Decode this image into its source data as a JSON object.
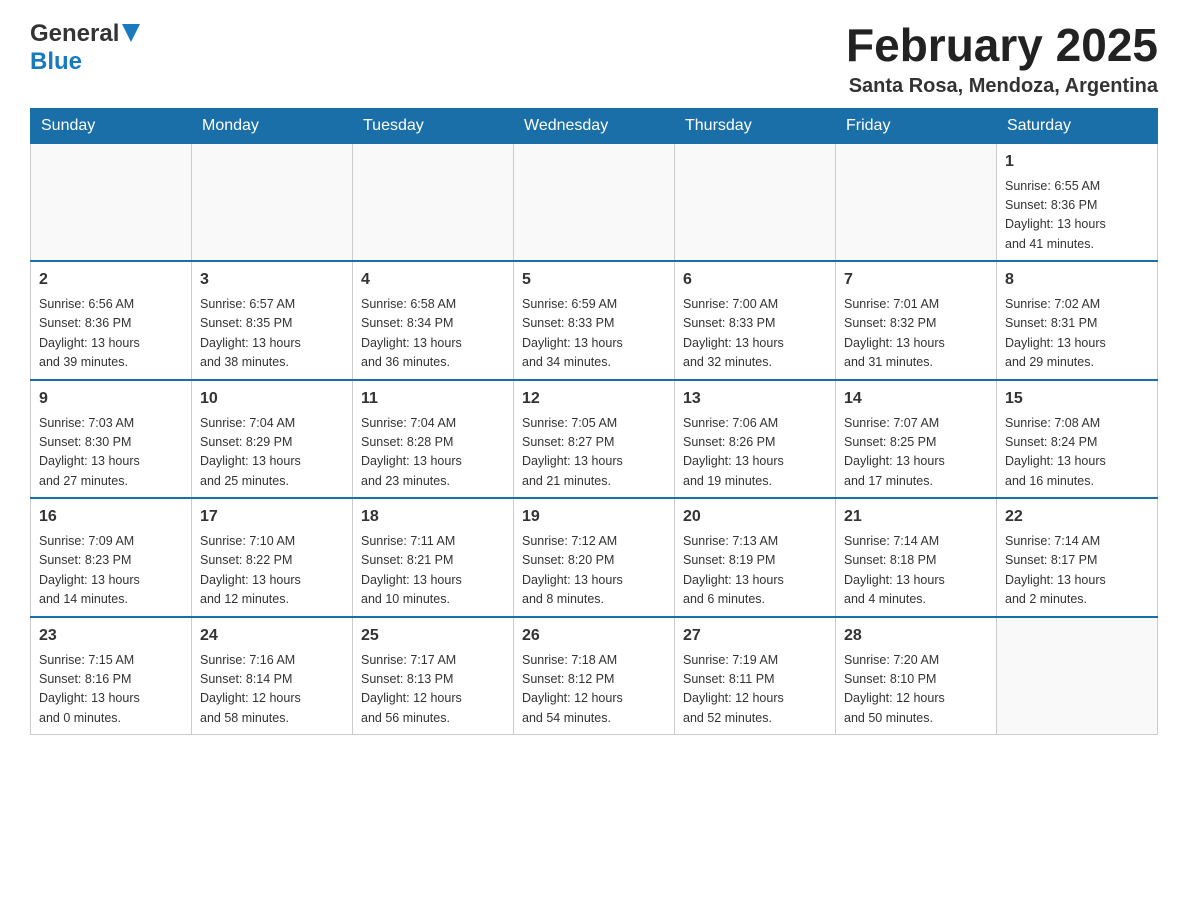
{
  "header": {
    "logo_general": "General",
    "logo_blue": "Blue",
    "month_title": "February 2025",
    "location": "Santa Rosa, Mendoza, Argentina"
  },
  "days_of_week": [
    "Sunday",
    "Monday",
    "Tuesday",
    "Wednesday",
    "Thursday",
    "Friday",
    "Saturday"
  ],
  "weeks": [
    [
      {
        "day": "",
        "info": ""
      },
      {
        "day": "",
        "info": ""
      },
      {
        "day": "",
        "info": ""
      },
      {
        "day": "",
        "info": ""
      },
      {
        "day": "",
        "info": ""
      },
      {
        "day": "",
        "info": ""
      },
      {
        "day": "1",
        "info": "Sunrise: 6:55 AM\nSunset: 8:36 PM\nDaylight: 13 hours\nand 41 minutes."
      }
    ],
    [
      {
        "day": "2",
        "info": "Sunrise: 6:56 AM\nSunset: 8:36 PM\nDaylight: 13 hours\nand 39 minutes."
      },
      {
        "day": "3",
        "info": "Sunrise: 6:57 AM\nSunset: 8:35 PM\nDaylight: 13 hours\nand 38 minutes."
      },
      {
        "day": "4",
        "info": "Sunrise: 6:58 AM\nSunset: 8:34 PM\nDaylight: 13 hours\nand 36 minutes."
      },
      {
        "day": "5",
        "info": "Sunrise: 6:59 AM\nSunset: 8:33 PM\nDaylight: 13 hours\nand 34 minutes."
      },
      {
        "day": "6",
        "info": "Sunrise: 7:00 AM\nSunset: 8:33 PM\nDaylight: 13 hours\nand 32 minutes."
      },
      {
        "day": "7",
        "info": "Sunrise: 7:01 AM\nSunset: 8:32 PM\nDaylight: 13 hours\nand 31 minutes."
      },
      {
        "day": "8",
        "info": "Sunrise: 7:02 AM\nSunset: 8:31 PM\nDaylight: 13 hours\nand 29 minutes."
      }
    ],
    [
      {
        "day": "9",
        "info": "Sunrise: 7:03 AM\nSunset: 8:30 PM\nDaylight: 13 hours\nand 27 minutes."
      },
      {
        "day": "10",
        "info": "Sunrise: 7:04 AM\nSunset: 8:29 PM\nDaylight: 13 hours\nand 25 minutes."
      },
      {
        "day": "11",
        "info": "Sunrise: 7:04 AM\nSunset: 8:28 PM\nDaylight: 13 hours\nand 23 minutes."
      },
      {
        "day": "12",
        "info": "Sunrise: 7:05 AM\nSunset: 8:27 PM\nDaylight: 13 hours\nand 21 minutes."
      },
      {
        "day": "13",
        "info": "Sunrise: 7:06 AM\nSunset: 8:26 PM\nDaylight: 13 hours\nand 19 minutes."
      },
      {
        "day": "14",
        "info": "Sunrise: 7:07 AM\nSunset: 8:25 PM\nDaylight: 13 hours\nand 17 minutes."
      },
      {
        "day": "15",
        "info": "Sunrise: 7:08 AM\nSunset: 8:24 PM\nDaylight: 13 hours\nand 16 minutes."
      }
    ],
    [
      {
        "day": "16",
        "info": "Sunrise: 7:09 AM\nSunset: 8:23 PM\nDaylight: 13 hours\nand 14 minutes."
      },
      {
        "day": "17",
        "info": "Sunrise: 7:10 AM\nSunset: 8:22 PM\nDaylight: 13 hours\nand 12 minutes."
      },
      {
        "day": "18",
        "info": "Sunrise: 7:11 AM\nSunset: 8:21 PM\nDaylight: 13 hours\nand 10 minutes."
      },
      {
        "day": "19",
        "info": "Sunrise: 7:12 AM\nSunset: 8:20 PM\nDaylight: 13 hours\nand 8 minutes."
      },
      {
        "day": "20",
        "info": "Sunrise: 7:13 AM\nSunset: 8:19 PM\nDaylight: 13 hours\nand 6 minutes."
      },
      {
        "day": "21",
        "info": "Sunrise: 7:14 AM\nSunset: 8:18 PM\nDaylight: 13 hours\nand 4 minutes."
      },
      {
        "day": "22",
        "info": "Sunrise: 7:14 AM\nSunset: 8:17 PM\nDaylight: 13 hours\nand 2 minutes."
      }
    ],
    [
      {
        "day": "23",
        "info": "Sunrise: 7:15 AM\nSunset: 8:16 PM\nDaylight: 13 hours\nand 0 minutes."
      },
      {
        "day": "24",
        "info": "Sunrise: 7:16 AM\nSunset: 8:14 PM\nDaylight: 12 hours\nand 58 minutes."
      },
      {
        "day": "25",
        "info": "Sunrise: 7:17 AM\nSunset: 8:13 PM\nDaylight: 12 hours\nand 56 minutes."
      },
      {
        "day": "26",
        "info": "Sunrise: 7:18 AM\nSunset: 8:12 PM\nDaylight: 12 hours\nand 54 minutes."
      },
      {
        "day": "27",
        "info": "Sunrise: 7:19 AM\nSunset: 8:11 PM\nDaylight: 12 hours\nand 52 minutes."
      },
      {
        "day": "28",
        "info": "Sunrise: 7:20 AM\nSunset: 8:10 PM\nDaylight: 12 hours\nand 50 minutes."
      },
      {
        "day": "",
        "info": ""
      }
    ]
  ]
}
